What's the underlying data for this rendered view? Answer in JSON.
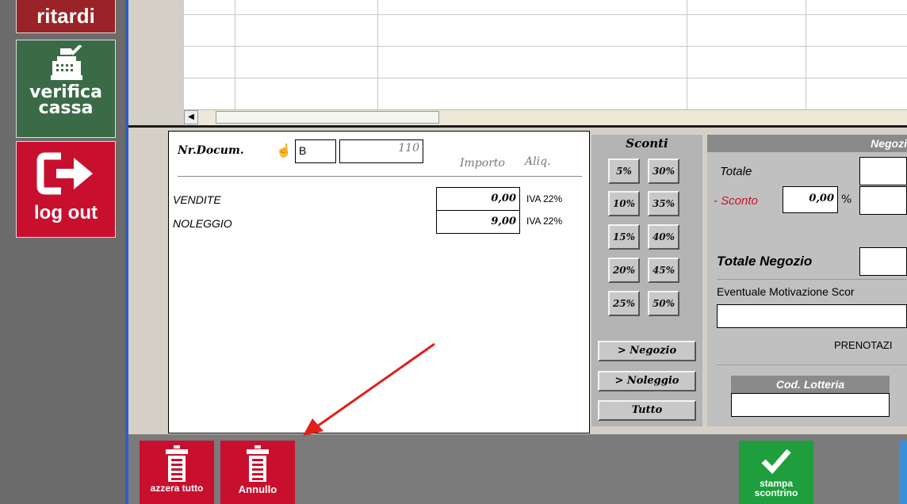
{
  "sidebar": {
    "ritardi": "ritardi",
    "verifica_cassa": [
      "verifica",
      "cassa"
    ],
    "logout": "log out"
  },
  "doc": {
    "nr_docum_label": "Nr.Docum.",
    "series": "B",
    "number": "110",
    "importo_header": "Importo",
    "aliq_header": "Aliq.",
    "rows": [
      {
        "label": "VENDITE",
        "importo": "0,00",
        "aliq": "IVA 22%"
      },
      {
        "label": "NOLEGGIO",
        "importo": "9,00",
        "aliq": "IVA 22%"
      }
    ]
  },
  "sconti": {
    "title": "Sconti",
    "buttons": [
      "5%",
      "30%",
      "10%",
      "35%",
      "15%",
      "40%",
      "20%",
      "45%",
      "25%",
      "50%"
    ],
    "to_negozio": "> Negozio",
    "to_noleggio": "> Noleggio",
    "tutto": "Tutto"
  },
  "negozio": {
    "header": "Negozi",
    "totale": "Totale",
    "sconto_label": "- Sconto",
    "sconto_value": "0,00",
    "percent": "%",
    "totale_negozio": "Totale Negozio",
    "motivazione": "Eventuale Motivazione Scor",
    "prenotazioni": "PRENOTAZI",
    "cod_lotteria": "Cod. Lotteria"
  },
  "toolbar": {
    "azzera": "azzera tutto",
    "annullo": "Annullo",
    "stampa": "stampa scontrino"
  },
  "colors": {
    "red_button": "#c8102e",
    "green_button": "#1e9e3c",
    "sidebar_green": "#3a6b46"
  }
}
